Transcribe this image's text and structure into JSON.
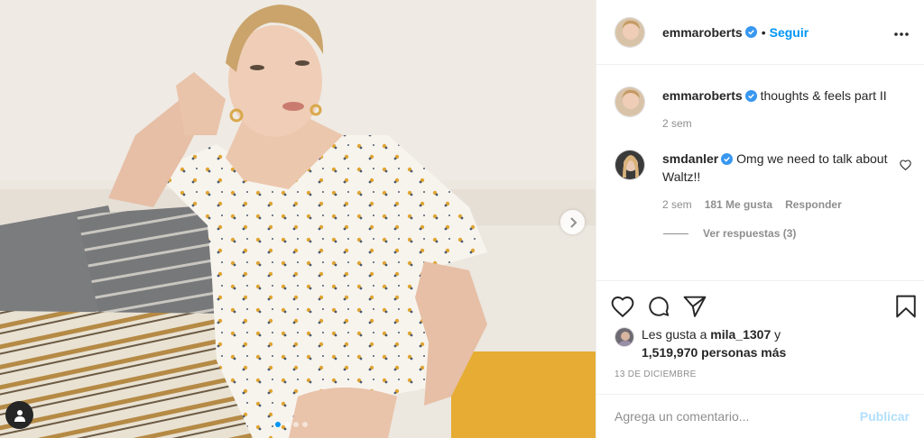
{
  "post": {
    "author": {
      "username": "emmaroberts",
      "verified": true,
      "follow_label": "Seguir",
      "separator": "•"
    },
    "more_icon": "more-horizontal-icon",
    "caption": {
      "username": "emmaroberts",
      "text": "thoughts & feels part II",
      "time": "2 sem"
    },
    "comments": [
      {
        "username": "smdanler",
        "verified": true,
        "text": "Omg we need to talk about Waltz!!",
        "time": "2 sem",
        "likes": "181 Me gusta",
        "reply_label": "Responder",
        "view_replies_label": "Ver respuestas (3)"
      }
    ],
    "actions": {
      "like_icon": "heart-icon",
      "comment_icon": "comment-icon",
      "share_icon": "paper-plane-icon",
      "save_icon": "bookmark-icon"
    },
    "likes": {
      "prefix": "Les gusta a",
      "first_user": "mila_1307",
      "conjunction": "y",
      "others": "1,519,970 personas más"
    },
    "date": "13 DE DICIEMBRE",
    "add_comment": {
      "placeholder": "Agrega un comentario...",
      "publish_label": "Publicar"
    },
    "carousel": {
      "total": 4,
      "active_index": 0
    }
  },
  "colors": {
    "link_blue": "#0095f6",
    "publish_disabled": "#b2dffc",
    "muted": "#8e8e8e",
    "text": "#262626"
  }
}
